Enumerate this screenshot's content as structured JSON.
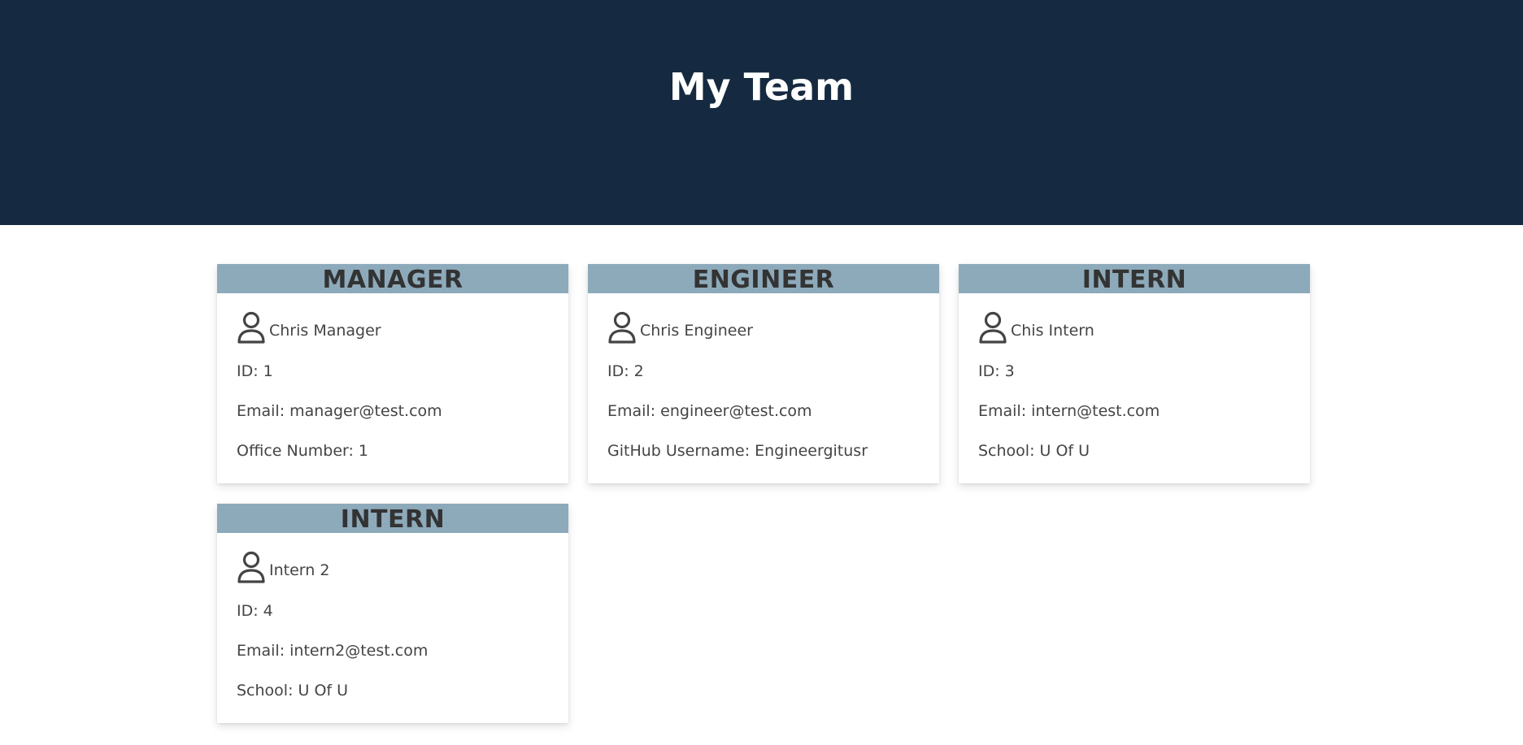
{
  "page": {
    "title": "My Team"
  },
  "team": [
    {
      "role": "MANAGER",
      "name": "Chris Manager",
      "id_text": "ID: 1",
      "email_text": "Email: manager@test.com",
      "extra_text": "Office Number: 1",
      "icon": "person-icon"
    },
    {
      "role": "ENGINEER",
      "name": "Chris Engineer",
      "id_text": "ID: 2",
      "email_text": "Email: engineer@test.com",
      "extra_text": "GitHub Username: Engineergitusr",
      "icon": "person-icon"
    },
    {
      "role": "INTERN",
      "name": "Chis Intern",
      "id_text": "ID: 3",
      "email_text": "Email: intern@test.com",
      "extra_text": "School: U Of U",
      "icon": "person-icon"
    },
    {
      "role": "INTERN",
      "name": "Intern 2",
      "id_text": "ID: 4",
      "email_text": "Email: intern2@test.com",
      "extra_text": "School: U Of U",
      "icon": "person-icon"
    }
  ],
  "colors": {
    "hero_background": "#152a40",
    "card_header": "#8daabb",
    "text": "#444444"
  }
}
